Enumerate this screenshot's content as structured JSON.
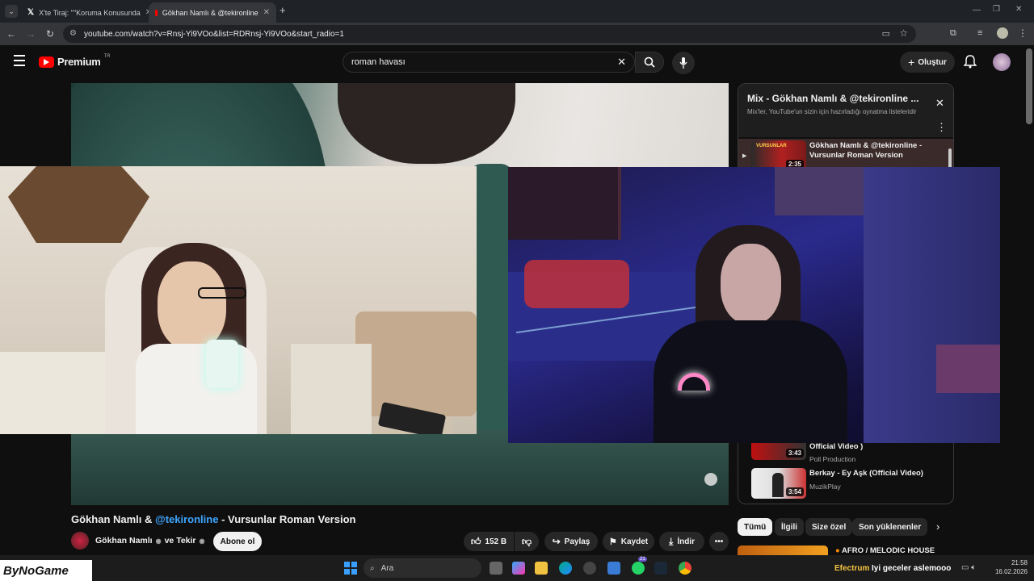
{
  "browser": {
    "tabs": [
      {
        "title": "X'te Tiraj: \"\"Koruma Konusunda",
        "favicon": "x-logo-icon"
      },
      {
        "title": "Gökhan Namlı & @tekironline",
        "favicon": "youtube-icon"
      }
    ],
    "url": "youtube.com/watch?v=Rnsj-Yi9VOo&list=RDRnsj-Yi9VOo&start_radio=1"
  },
  "youtube": {
    "logo": "Premium",
    "region": "TR",
    "search_value": "roman havası",
    "create_label": "Oluştur"
  },
  "video": {
    "title_prefix": "Gökhan Namlı & ",
    "title_mention": "@tekironline",
    "title_suffix": " - Vursunlar Roman Version",
    "channel": "Gökhan Namlı",
    "channel_and": "ve Tekir",
    "subscribe": "Abone ol",
    "likes": "152 B",
    "share": "Paylaş",
    "save": "Kaydet",
    "download": "İndir"
  },
  "playlist": {
    "title": "Mix - Gökhan Namlı & @tekironline ...",
    "subtitle": "Mix'ler, YouTube'un sizin için hazırladığı oynatma listeleridir",
    "items": [
      {
        "title": "Gökhan Namlı & @tekironline - Vursunlar Roman Version",
        "channel": "",
        "duration": "2:35",
        "thumb_text": "VURSUNLAR"
      },
      {
        "title": "Official Video )",
        "channel": "Poll Production",
        "duration": "3:43"
      },
      {
        "title": "Berkay - Ey Aşk (Official Video)",
        "channel": "MuzikPlay",
        "duration": "3:54"
      }
    ]
  },
  "chips": [
    "Tümü",
    "İlgili",
    "Size özel",
    "Son yüklenenler"
  ],
  "next_item_label": "AFRO / MELODIC HOUSE",
  "overlay": {
    "brand": "ByNoGame",
    "ticker_label": "Efectrum",
    "ticker_text": "Iyi geceler aslemooo"
  },
  "taskbar": {
    "search": "Ara",
    "time": "21:58",
    "date": "16.02.2026",
    "whatsapp_badge": "21"
  },
  "colors": {
    "youtube_red": "#ff0000",
    "link_blue": "#3ea6ff",
    "bg": "#0f0f0f"
  }
}
